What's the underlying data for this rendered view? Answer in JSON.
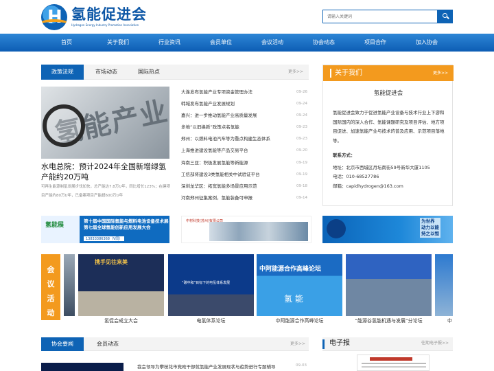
{
  "header": {
    "logo_letter": "H",
    "site_title": "氢能促进会",
    "site_subtitle": "Hydrogen Energy Industry Promotion Association",
    "search_placeholder": "请输入关键词"
  },
  "nav": {
    "items": [
      "首页",
      "关于我们",
      "行业资讯",
      "会员单位",
      "会议活动",
      "协会动态",
      "项目合作",
      "加入协会"
    ]
  },
  "news": {
    "tabs": [
      "政策法规",
      "市场动态",
      "国际热点"
    ],
    "more": "更多>>",
    "feature": {
      "image_text": "氢能产业",
      "title": "水电总院：预计2024年全国新增绿氢产能约20万吨",
      "desc": "可再生能源制氢发展步伐加快，总产能达7.8万t/年，同比增长123%；在建项目产能约80万t/年，已备案项目产能超600万t/年"
    },
    "items": [
      {
        "title": "大连发布氢能产业专项资金管理办法",
        "date": "09-26"
      },
      {
        "title": "韩城发布氢能产业发展规划",
        "date": "09-24"
      },
      {
        "title": "嘉兴：进一步推动氢能产业高质量发展",
        "date": "09-24"
      },
      {
        "title": "多地“以旧换新”政策点名氢能",
        "date": "09-23"
      },
      {
        "title": "郑州：以燃料电池汽车等为重点构建生态体系",
        "date": "09-23"
      },
      {
        "title": "上海推进建设氢能等产品交易平台",
        "date": "09-20"
      },
      {
        "title": "海南三亚：积极发展氢能等新能源",
        "date": "09-19"
      },
      {
        "title": "工信部将建设3类氢能相关中试验证平台",
        "date": "09-19"
      },
      {
        "title": "深圳龙华区：拓宽氢能多场景应用示范",
        "date": "09-18"
      },
      {
        "title": "河南郑州征集案例，氢能装备可申报",
        "date": "09-14"
      }
    ]
  },
  "about": {
    "title": "关于我们",
    "more": "更多>>",
    "name": "氢能促进会",
    "body": "氢能促进会致力于促进氢能产业设备与技术行业上下游和国际国内的深入合作、氢能课题研究及项目评估、地方项目促进、加速氢能产业与技术的普及应用、示范项目落地等。",
    "contact_label": "联系方式：",
    "address": "地址：北京市西城区月坛南街59号新华大厦1105",
    "phone": "电话：010-68527786",
    "email": "邮箱：capidhydrogen@163.com"
  },
  "banners": {
    "b1_logo": "氢能展",
    "b1_line1": "第十届中国国际氢能与燃料电池设备技术展",
    "b1_line2": "第七届全球氢能创新应用发展大会",
    "b1_phone": "13833386368（V同）",
    "b2_logo": "中材科技(苏州)有限公司",
    "b3_line1": "为世界",
    "b3_line2": "动力以能",
    "b3_line3": "持之以恒"
  },
  "meetings": {
    "label": [
      "会",
      "议",
      "活",
      "动"
    ],
    "items": [
      {
        "caption": "氢促会成立大会",
        "banner_text": "携手见往来美"
      },
      {
        "caption": "电氢体系论坛",
        "banner_text": "“碳中和”目标下的电氢体系发展"
      },
      {
        "caption": "中阿能源合作高峰论坛",
        "banner_text": "中阿能源合作高峰论坛",
        "banner_sub": "氢  能"
      },
      {
        "caption": "“能源谷氢能机遇与发展”分论坛",
        "banner_text": ""
      },
      {
        "caption": "中",
        "banner_text": ""
      }
    ]
  },
  "bottom": {
    "tabs": [
      "协会要闻",
      "会员动态"
    ],
    "more": "更多>>",
    "first_news": "我会领导为攀枝花市党政干部就氢能产业发展现状与趋势进行专题辅导",
    "first_date": "09-03"
  },
  "epaper": {
    "title": "电子报",
    "more": "往期电子报>>"
  },
  "colors": {
    "brand_blue": "#0e63b5",
    "accent_orange": "#f39a1e"
  }
}
